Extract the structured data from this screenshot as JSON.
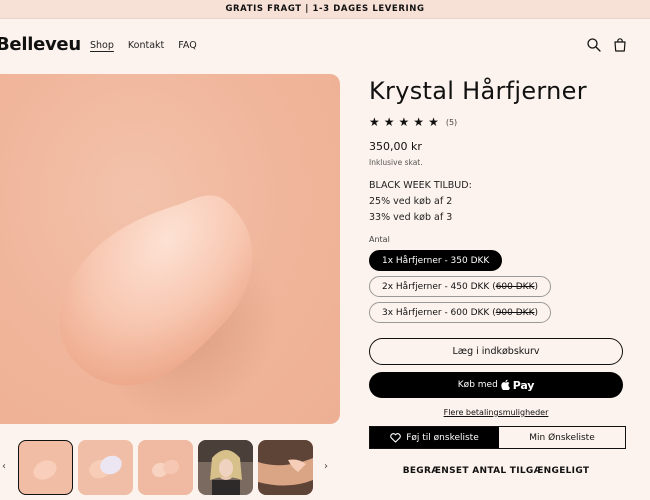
{
  "announcement": "GRATIS FRAGT | 1-3 DAGES LEVERING",
  "brand": "Belleveu",
  "nav": {
    "shop": "Shop",
    "contact": "Kontakt",
    "faq": "FAQ"
  },
  "header_icons": [
    "search-icon",
    "cart-icon"
  ],
  "product": {
    "title": "Krystal Hårfjerner",
    "rating_stars": 5,
    "review_count": "(5)",
    "price": "350,00 kr",
    "tax_note": "Inklusive skat.",
    "offer_heading": "BLACK WEEK TILBUD:",
    "offer_line1": "25% ved køb af 2",
    "offer_line2": "33% ved køb af 3"
  },
  "quantity": {
    "label": "Antal",
    "options": [
      {
        "text": "1x Hårfjerner - 350 DKK",
        "old": "",
        "selected": true
      },
      {
        "text": "2x Hårfjerner - 450 DKK (",
        "old": "600 DKK",
        "close": ")",
        "selected": false
      },
      {
        "text": "3x Hårfjerner - 600 DKK (",
        "old": "900 DKK",
        "close": ")",
        "selected": false
      }
    ]
  },
  "actions": {
    "add_to_cart": "Læg i indkøbskurv",
    "buy_with": "Køb med",
    "apple_pay": "Pay",
    "more_payment": "Flere betalingsmuligheder",
    "add_wishlist": "Føj til ønskeliste",
    "my_wishlist": "Min Ønskeliste"
  },
  "limited_notice": "BEGRÆNSET ANTAL TILGÆNGELIGT",
  "gallery": {
    "prev": "‹",
    "next": "›",
    "thumbnail_count": 5,
    "selected_index": 0
  },
  "colors": {
    "background": "#fdf3ee",
    "announcement_bg": "#f7e1d7",
    "accent": "#000000",
    "product_bg": "#f0b59a"
  }
}
